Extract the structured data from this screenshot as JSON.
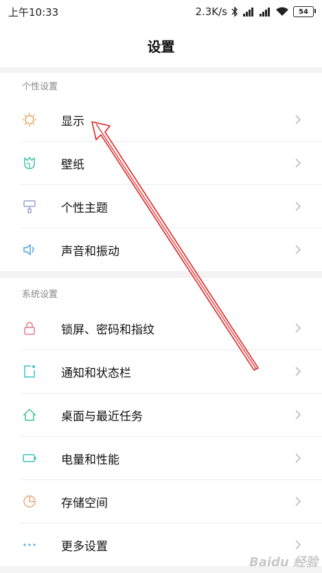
{
  "status": {
    "time": "上午10:33",
    "speed": "2.3K/s",
    "battery": "54"
  },
  "header": {
    "title": "设置"
  },
  "sections": {
    "personal": {
      "title": "个性设置",
      "items": [
        "显示",
        "壁纸",
        "个性主题",
        "声音和振动"
      ]
    },
    "system": {
      "title": "系统设置",
      "items": [
        "锁屏、密码和指纹",
        "通知和状态栏",
        "桌面与最近任务",
        "电量和性能",
        "存储空间",
        "更多设置"
      ]
    }
  },
  "colors": {
    "display_icon": "#e8a24a",
    "wallpaper_icon": "#3cc3a8",
    "theme_icon": "#9aa0c8",
    "sound_icon": "#4aa3e0",
    "lock_icon": "#e07a8a",
    "notify_icon": "#3cc3c3",
    "home_icon": "#3cc39a",
    "battery_icon": "#3cc3b8",
    "storage_icon": "#e8a878",
    "more_icon": "#5ab0e0",
    "annotation_arrow": "#e02020"
  },
  "watermark": "Baidu 经验"
}
